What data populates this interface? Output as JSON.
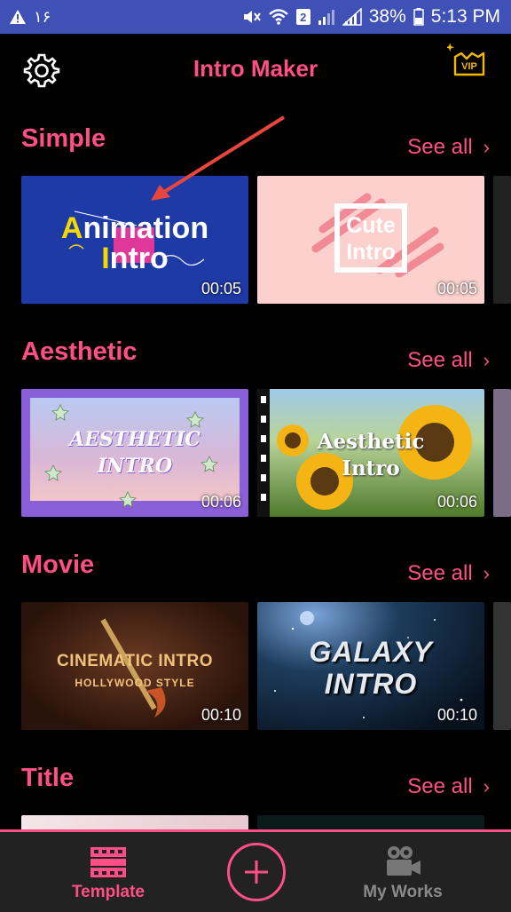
{
  "status_bar": {
    "left_text": "۱۶",
    "sim_number": "2",
    "battery": "38%",
    "time": "5:13 PM"
  },
  "header": {
    "title": "Intro Maker",
    "vip_label": "VIP",
    "settings_icon": "gear-icon"
  },
  "sections": [
    {
      "title": "Simple",
      "see_all": "See all",
      "cards": [
        {
          "title_line1": "Animation",
          "title_line2": "Intro",
          "duration": "00:05"
        },
        {
          "title_line1": "Cute",
          "title_line2": "Intro",
          "duration": "00:05"
        }
      ]
    },
    {
      "title": "Aesthetic",
      "see_all": "See all",
      "cards": [
        {
          "title_line1": "AESTHETIC",
          "title_line2": "INTRO",
          "duration": "00:06"
        },
        {
          "title_line1": "Aesthetic",
          "title_line2": "Intro",
          "duration": "00:06"
        }
      ]
    },
    {
      "title": "Movie",
      "see_all": "See all",
      "cards": [
        {
          "title_line1": "CINEMATIC INTRO",
          "title_line2": "HOLLYWOOD STYLE",
          "duration": "00:10"
        },
        {
          "title_line1": "GALAXY",
          "title_line2": "INTRO",
          "duration": "00:10"
        }
      ]
    },
    {
      "title": "Title",
      "see_all": "See all",
      "cards": []
    }
  ],
  "bottom_nav": {
    "template_label": "Template",
    "my_works_label": "My Works"
  },
  "colors": {
    "accent": "#ff4f86",
    "status_bar": "#3f51b5",
    "background": "#000000",
    "nav_background": "#222222"
  }
}
